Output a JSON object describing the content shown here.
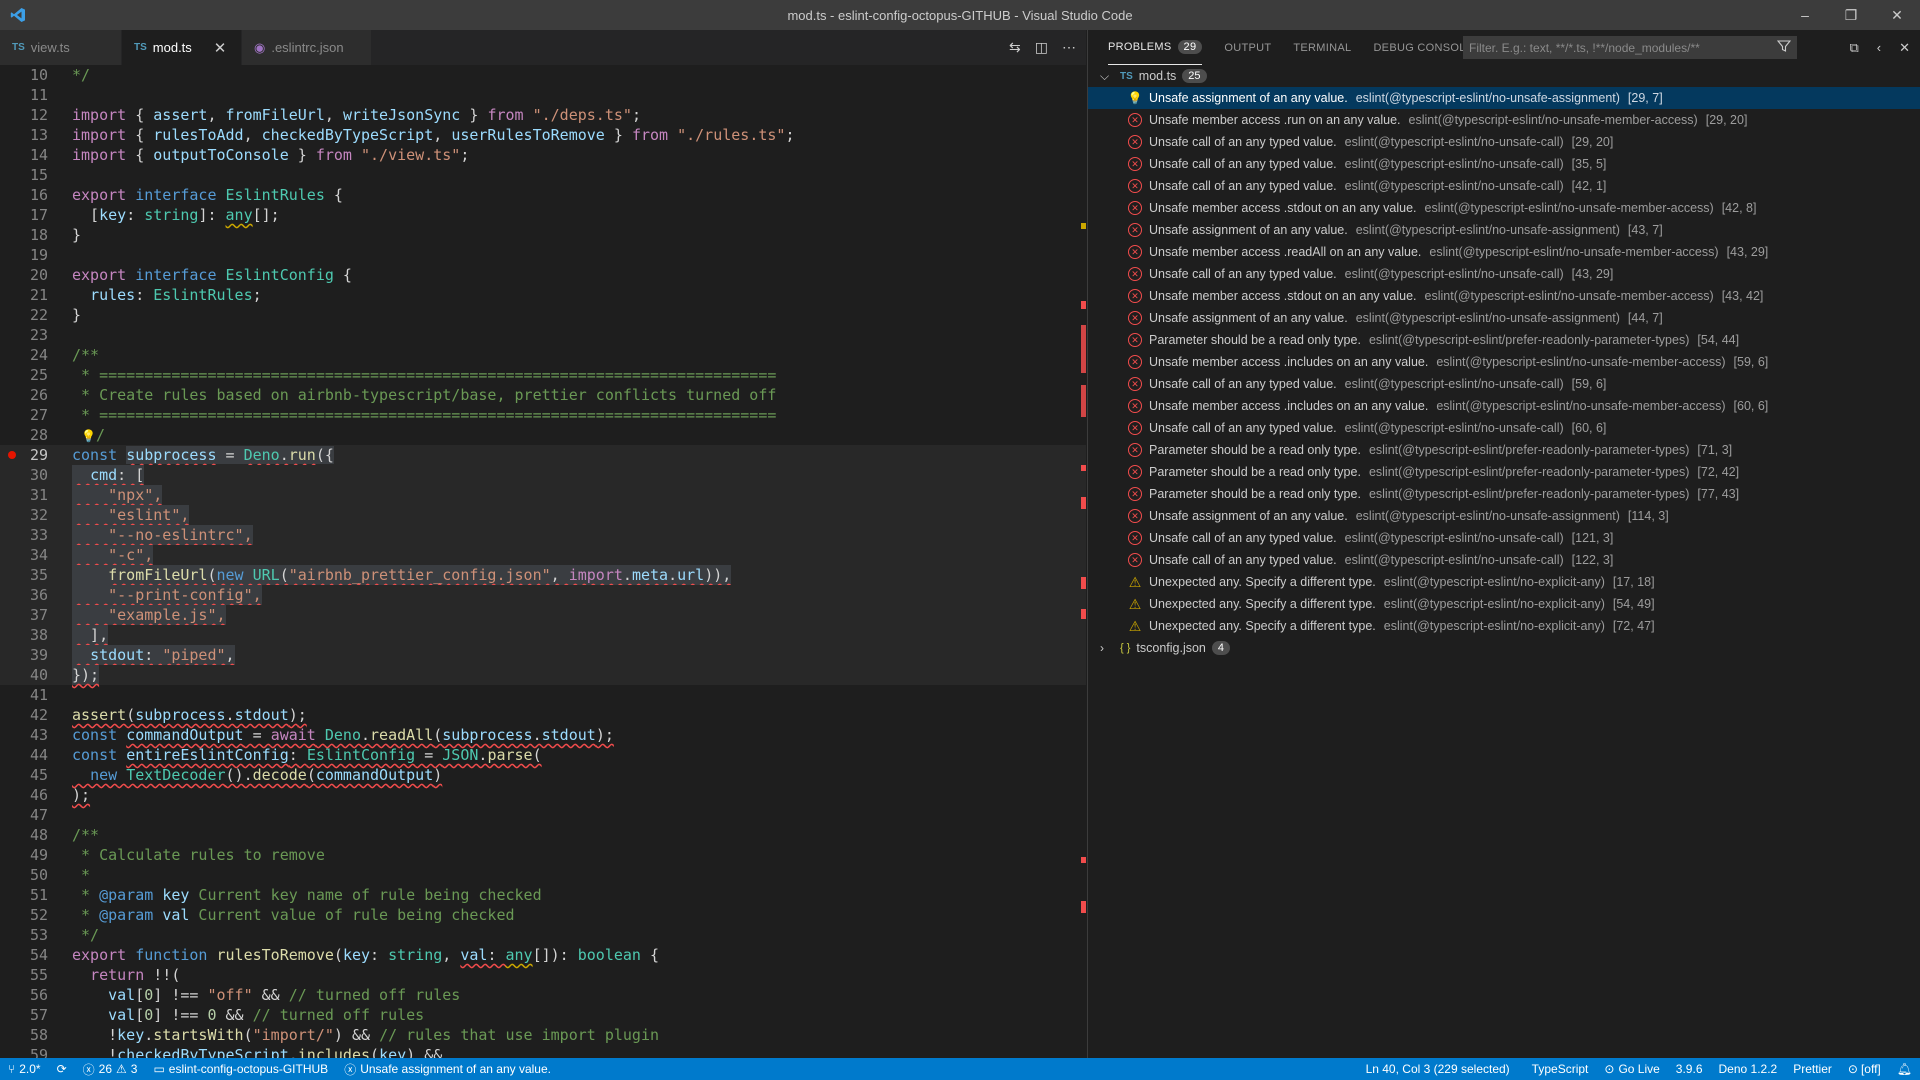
{
  "window": {
    "title": "mod.ts - eslint-config-octopus-GITHUB - Visual Studio Code",
    "minimize": "–",
    "restore": "❐",
    "close": "✕"
  },
  "tabs": [
    {
      "icon": "TS",
      "label": "view.ts"
    },
    {
      "icon": "TS",
      "label": "mod.ts",
      "close": "✕"
    },
    {
      "label": ".eslintrc.json"
    }
  ],
  "editor": {
    "line_numbers": [
      "10",
      "11",
      "12",
      "13",
      "14",
      "15",
      "16",
      "17",
      "18",
      "19",
      "20",
      "21",
      "22",
      "23",
      "24",
      "25",
      "26",
      "27",
      "28",
      "29",
      "30",
      "31",
      "32",
      "33",
      "34",
      "35",
      "36",
      "37",
      "38",
      "39",
      "40",
      "41",
      "42",
      "43",
      "44",
      "45",
      "46",
      "47",
      "48",
      "49",
      "50",
      "51",
      "52",
      "53",
      "54",
      "55",
      "56",
      "57",
      "58",
      "59"
    ],
    "code": {
      "l10": "*/",
      "l12a": "import",
      "l12b": " { ",
      "l12c": "assert",
      "l12d": ", ",
      "l12e": "fromFileUrl",
      "l12f": ", ",
      "l12g": "writeJsonSync",
      "l12h": " } ",
      "l12i": "from",
      "l12j": " ",
      "l12k": "\"./deps.ts\"",
      "l12l": ";",
      "l13a": "import",
      "l13b": " { ",
      "l13c": "rulesToAdd",
      "l13d": ", ",
      "l13e": "checkedByTypeScript",
      "l13f": ", ",
      "l13g": "userRulesToRemove",
      "l13h": " } ",
      "l13i": "from",
      "l13j": " ",
      "l13k": "\"./rules.ts\"",
      "l13l": ";",
      "l14a": "import",
      "l14b": " { ",
      "l14c": "outputToConsole",
      "l14d": " } ",
      "l14e": "from",
      "l14f": " ",
      "l14g": "\"./view.ts\"",
      "l14h": ";",
      "l16a": "export",
      "l16b": " ",
      "l16c": "interface",
      "l16d": " ",
      "l16e": "EslintRules",
      "l16f": " {",
      "l17a": "  [",
      "l17b": "key",
      "l17c": ": ",
      "l17d": "string",
      "l17e": "]: ",
      "l17f": "any",
      "l17g": "[];",
      "l18": "}",
      "l20a": "export",
      "l20b": " ",
      "l20c": "interface",
      "l20d": " ",
      "l20e": "EslintConfig",
      "l20f": " {",
      "l21a": "  ",
      "l21b": "rules",
      "l21c": ": ",
      "l21d": "EslintRules",
      "l21e": ";",
      "l22": "}",
      "l24": "/**",
      "l25": " * ===========================================================================",
      "l26": " * Create rules based on airbnb-typescript/base, prettier conflicts turned off",
      "l27": " * ===========================================================================",
      "l28a": " ",
      "l28b": "💡",
      "l28c": "/",
      "l29a": "const",
      "l29b": " ",
      "l29c": "subprocess",
      "l29d": " = ",
      "l29e": "Deno",
      "l29f": ".",
      "l29g": "run",
      "l29h": "({",
      "l30a": "  ",
      "l30b": "cmd",
      "l30c": ": [",
      "l31": "    \"npx\",",
      "l32": "    \"eslint\",",
      "l33": "    \"--no-eslintrc\",",
      "l34": "    \"-c\",",
      "l35a": "    ",
      "l35b": "fromFileUrl",
      "l35c": "(",
      "l35d": "new",
      "l35e": " ",
      "l35f": "URL",
      "l35g": "(",
      "l35h": "\"airbnb_prettier_config.json\"",
      "l35i": ", ",
      "l35j": "import",
      "l35k": ".",
      "l35l": "meta",
      "l35m": ".",
      "l35n": "url",
      "l35o": ")),",
      "l36": "    \"--print-config\",",
      "l37": "    \"example.js\",",
      "l38": "  ],",
      "l39a": "  ",
      "l39b": "stdout",
      "l39c": ": ",
      "l39d": "\"piped\"",
      "l39e": ",",
      "l40": "});",
      "l42a": "assert",
      "l42b": "(",
      "l42c": "subprocess",
      "l42d": ".",
      "l42e": "stdout",
      "l42f": ");",
      "l43a": "const",
      "l43b": " ",
      "l43c": "commandOutput",
      "l43d": " = ",
      "l43e": "await",
      "l43f": " ",
      "l43g": "Deno",
      "l43h": ".",
      "l43i": "readAll",
      "l43j": "(",
      "l43k": "subprocess",
      "l43l": ".",
      "l43m": "stdout",
      "l43n": ");",
      "l44a": "const",
      "l44b": " ",
      "l44c": "entireEslintConfig",
      "l44d": ": ",
      "l44e": "EslintConfig",
      "l44f": " = ",
      "l44g": "JSON",
      "l44h": ".",
      "l44i": "parse",
      "l44j": "(",
      "l45a": "  ",
      "l45b": "new",
      "l45c": " ",
      "l45d": "TextDecoder",
      "l45e": "().",
      "l45f": "decode",
      "l45g": "(",
      "l45h": "commandOutput",
      "l45i": ")",
      "l46": ");",
      "l48": "/**",
      "l49": " * Calculate rules to remove",
      "l50": " *",
      "l51a": " * ",
      "l51b": "@param",
      "l51c": " ",
      "l51d": "key",
      "l51e": " Current key name of rule being checked",
      "l52a": " * ",
      "l52b": "@param",
      "l52c": " ",
      "l52d": "val",
      "l52e": " Current value of rule being checked",
      "l53": " */",
      "l54a": "export",
      "l54b": " ",
      "l54c": "function",
      "l54d": " ",
      "l54e": "rulesToRemove",
      "l54f": "(",
      "l54g": "key",
      "l54h": ": ",
      "l54i": "string",
      "l54j": ", ",
      "l54k": "val",
      "l54l": ": ",
      "l54m": "any",
      "l54n": "[]): ",
      "l54o": "boolean",
      "l54p": " {",
      "l55a": "  ",
      "l55b": "return",
      "l55c": " !!(",
      "l56a": "    ",
      "l56b": "val",
      "l56c": "[",
      "l56d": "0",
      "l56e": "] !== ",
      "l56f": "\"off\"",
      "l56g": " && ",
      "l56h": "// turned off rules",
      "l57a": "    ",
      "l57b": "val",
      "l57c": "[",
      "l57d": "0",
      "l57e": "] !== ",
      "l57f": "0",
      "l57g": " && ",
      "l57h": "// turned off rules",
      "l58a": "    !",
      "l58b": "key",
      "l58c": ".",
      "l58d": "startsWith",
      "l58e": "(",
      "l58f": "\"import/\"",
      "l58g": ") && ",
      "l58h": "// rules that use import plugin",
      "l59a": "    !",
      "l59b": "checkedByTypeScript",
      "l59c": ".",
      "l59d": "includes",
      "l59e": "(",
      "l59f": "key",
      "l59g": ") &&"
    }
  },
  "panel": {
    "tabs": [
      {
        "label": "PROBLEMS",
        "badge": "29"
      },
      {
        "label": "OUTPUT"
      },
      {
        "label": "TERMINAL"
      },
      {
        "label": "DEBUG CONSOLE"
      }
    ],
    "filter_placeholder": "Filter. E.g.: text, **/*.ts, !**/node_modules/**",
    "files": [
      {
        "name": "mod.ts",
        "count": "25",
        "expanded": true
      },
      {
        "name": "tsconfig.json",
        "count": "4",
        "expanded": false
      }
    ],
    "problems": [
      {
        "severity": "bulb",
        "message": "Unsafe assignment of an any value.",
        "source": "eslint(@typescript-eslint/no-unsafe-assignment)",
        "position": "[29, 7]"
      },
      {
        "severity": "error",
        "message": "Unsafe member access .run on an any value.",
        "source": "eslint(@typescript-eslint/no-unsafe-member-access)",
        "position": "[29, 20]"
      },
      {
        "severity": "error",
        "message": "Unsafe call of an any typed value.",
        "source": "eslint(@typescript-eslint/no-unsafe-call)",
        "position": "[29, 20]"
      },
      {
        "severity": "error",
        "message": "Unsafe call of an any typed value.",
        "source": "eslint(@typescript-eslint/no-unsafe-call)",
        "position": "[35, 5]"
      },
      {
        "severity": "error",
        "message": "Unsafe call of an any typed value.",
        "source": "eslint(@typescript-eslint/no-unsafe-call)",
        "position": "[42, 1]"
      },
      {
        "severity": "error",
        "message": "Unsafe member access .stdout on an any value.",
        "source": "eslint(@typescript-eslint/no-unsafe-member-access)",
        "position": "[42, 8]"
      },
      {
        "severity": "error",
        "message": "Unsafe assignment of an any value.",
        "source": "eslint(@typescript-eslint/no-unsafe-assignment)",
        "position": "[43, 7]"
      },
      {
        "severity": "error",
        "message": "Unsafe member access .readAll on an any value.",
        "source": "eslint(@typescript-eslint/no-unsafe-member-access)",
        "position": "[43, 29]"
      },
      {
        "severity": "error",
        "message": "Unsafe call of an any typed value.",
        "source": "eslint(@typescript-eslint/no-unsafe-call)",
        "position": "[43, 29]"
      },
      {
        "severity": "error",
        "message": "Unsafe member access .stdout on an any value.",
        "source": "eslint(@typescript-eslint/no-unsafe-member-access)",
        "position": "[43, 42]"
      },
      {
        "severity": "error",
        "message": "Unsafe assignment of an any value.",
        "source": "eslint(@typescript-eslint/no-unsafe-assignment)",
        "position": "[44, 7]"
      },
      {
        "severity": "error",
        "message": "Parameter should be a read only type.",
        "source": "eslint(@typescript-eslint/prefer-readonly-parameter-types)",
        "position": "[54, 44]"
      },
      {
        "severity": "error",
        "message": "Unsafe member access .includes on an any value.",
        "source": "eslint(@typescript-eslint/no-unsafe-member-access)",
        "position": "[59, 6]"
      },
      {
        "severity": "error",
        "message": "Unsafe call of an any typed value.",
        "source": "eslint(@typescript-eslint/no-unsafe-call)",
        "position": "[59, 6]"
      },
      {
        "severity": "error",
        "message": "Unsafe member access .includes on an any value.",
        "source": "eslint(@typescript-eslint/no-unsafe-member-access)",
        "position": "[60, 6]"
      },
      {
        "severity": "error",
        "message": "Unsafe call of an any typed value.",
        "source": "eslint(@typescript-eslint/no-unsafe-call)",
        "position": "[60, 6]"
      },
      {
        "severity": "error",
        "message": "Parameter should be a read only type.",
        "source": "eslint(@typescript-eslint/prefer-readonly-parameter-types)",
        "position": "[71, 3]"
      },
      {
        "severity": "error",
        "message": "Parameter should be a read only type.",
        "source": "eslint(@typescript-eslint/prefer-readonly-parameter-types)",
        "position": "[72, 42]"
      },
      {
        "severity": "error",
        "message": "Parameter should be a read only type.",
        "source": "eslint(@typescript-eslint/prefer-readonly-parameter-types)",
        "position": "[77, 43]"
      },
      {
        "severity": "error",
        "message": "Unsafe assignment of an any value.",
        "source": "eslint(@typescript-eslint/no-unsafe-assignment)",
        "position": "[114, 3]"
      },
      {
        "severity": "error",
        "message": "Unsafe call of an any typed value.",
        "source": "eslint(@typescript-eslint/no-unsafe-call)",
        "position": "[121, 3]"
      },
      {
        "severity": "error",
        "message": "Unsafe call of an any typed value.",
        "source": "eslint(@typescript-eslint/no-unsafe-call)",
        "position": "[122, 3]"
      },
      {
        "severity": "warn",
        "message": "Unexpected any. Specify a different type.",
        "source": "eslint(@typescript-eslint/no-explicit-any)",
        "position": "[17, 18]"
      },
      {
        "severity": "warn",
        "message": "Unexpected any. Specify a different type.",
        "source": "eslint(@typescript-eslint/no-explicit-any)",
        "position": "[54, 49]"
      },
      {
        "severity": "warn",
        "message": "Unexpected any. Specify a different type.",
        "source": "eslint(@typescript-eslint/no-explicit-any)",
        "position": "[72, 47]"
      }
    ]
  },
  "statusbar": {
    "branch": "2.0*",
    "sync": "⟳",
    "errors": "26",
    "warnings": "3",
    "folder": "eslint-config-octopus-GITHUB",
    "current_problem": "Unsafe assignment of an any value.",
    "cursor": "Ln 40, Col 3 (229 selected)",
    "language": "TypeScript",
    "go_live": "Go Live",
    "ts_version": "3.9.6",
    "deno": "Deno 1.2.2",
    "prettier": "Prettier",
    "off": "[off]"
  },
  "colors": {
    "accent": "#007acc",
    "error": "#f14c4c",
    "warning": "#cca700",
    "selection": "#04395e"
  }
}
